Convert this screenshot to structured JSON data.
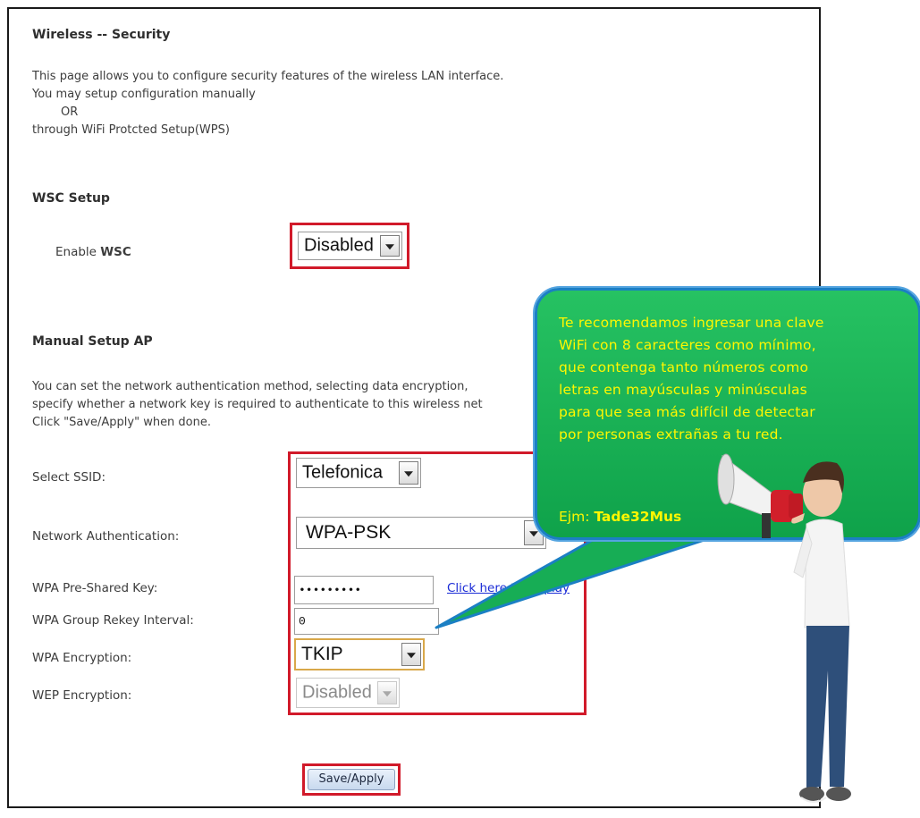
{
  "page": {
    "title": "Wireless -- Security",
    "intro_lines": [
      "This page allows you to configure security features of the wireless LAN interface.",
      "You may setup configuration manually",
      "OR",
      "through WiFi Protcted Setup(WPS)"
    ]
  },
  "wsc": {
    "section_title": "WSC Setup",
    "enable_label_prefix": "Enable ",
    "enable_label_bold": "WSC",
    "enable_value": "Disabled"
  },
  "manual": {
    "section_title": "Manual Setup AP",
    "desc_lines": [
      "You can set the network authentication method, selecting data encryption,",
      "specify whether a network key is required to authenticate to this wireless net",
      "Click \"Save/Apply\" when done."
    ],
    "ssid_label": "Select SSID:",
    "ssid_value": "Telefonica",
    "auth_label": "Network Authentication:",
    "auth_value": "WPA-PSK",
    "psk_label": "WPA Pre-Shared Key:",
    "psk_value": "•••••••••",
    "psk_link": "Click here to display",
    "rekey_label": "WPA Group Rekey Interval:",
    "rekey_value": "0",
    "enc_label": "WPA Encryption:",
    "enc_value": "TKIP",
    "wep_label": "WEP Encryption:",
    "wep_value": "Disabled",
    "save_label": "Save/Apply"
  },
  "tip": {
    "lines": [
      "Te recomendamos ingresar una clave",
      "WiFi con 8 caracteres como mínimo,",
      "que contenga tanto números como",
      "letras en mayúsculas y minúsculas",
      "para que sea más difícil de detectar",
      "por personas extrañas a tu red."
    ],
    "example_prefix": "Ejm: ",
    "example_value": "Tade32Mus"
  },
  "colors": {
    "highlight_border": "#d11a2a",
    "bubble_fill": "#17ad55",
    "bubble_text": "#fff700",
    "bubble_border": "#1b7fc4"
  },
  "icons": {
    "dropdown": "chevron-down-icon",
    "megaphone": "megaphone-icon"
  }
}
